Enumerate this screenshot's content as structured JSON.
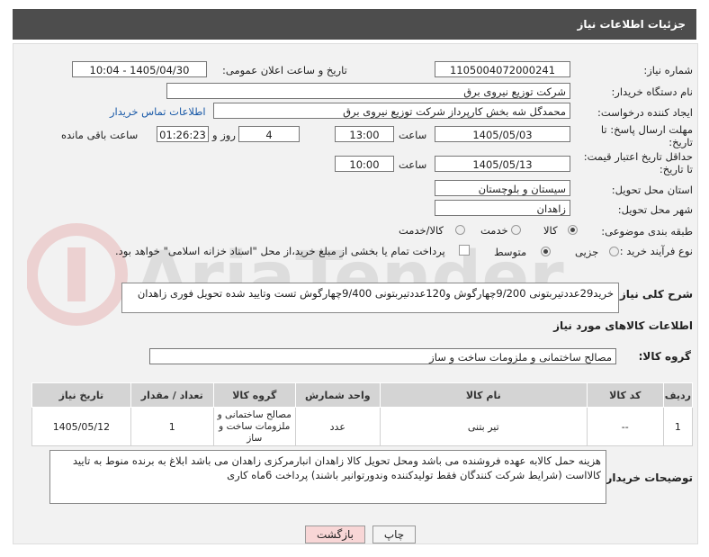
{
  "header": {
    "title": "جزئیات اطلاعات نیاز"
  },
  "fields": {
    "need_number_label": "شماره نیاز:",
    "need_number": "1105004072000241",
    "announce_label": "تاریخ و ساعت اعلان عمومی:",
    "announce_value": "1405/04/30 - 10:04",
    "buyer_org_label": "نام دستگاه خریدار:",
    "buyer_org": "شرکت توزیع نیروی برق",
    "requester_label": "ایجاد کننده درخواست:",
    "requester": "محمدگل شه بخش کارپرداز شرکت توزیع نیروی برق",
    "buyer_contact_link": "اطلاعات تماس خریدار",
    "deadline_label": "مهلت ارسال پاسخ: تا تاریخ:",
    "deadline_date": "1405/05/03",
    "time_label": "ساعت",
    "deadline_time": "13:00",
    "days_value": "4",
    "days_label": "روز و",
    "remaining_time": "01:26:23",
    "remaining_label": "ساعت باقی مانده",
    "validity_label": "حداقل تاریخ اعتبار قیمت: تا تاریخ:",
    "validity_date": "1405/05/13",
    "validity_time": "10:00",
    "province_label": "استان محل تحویل:",
    "province": "سیستان و بلوچستان",
    "city_label": "شهر محل تحویل:",
    "city": "زاهدان",
    "category_label": "طبقه بندی موضوعی:",
    "category_options": [
      "کالا",
      "خدمت",
      "کالا/خدمت"
    ],
    "process_label": "نوع فرآیند خرید :",
    "process_options": [
      "جزیی",
      "متوسط"
    ],
    "payment_note": "پرداخت تمام یا بخشی از مبلغ خرید،از محل \"اسناد خزانه اسلامی\" خواهد بود.",
    "description_label": "شرح کلی نیاز:",
    "description": "خرید29عددتیربتونی 9/200چهارگوش و120عددتیربتونی 9/400چهارگوش تست وتایید شده تحویل فوری زاهدان",
    "goods_info_title": "اطلاعات کالاهای مورد نیاز",
    "goods_group_label": "گروه کالا:",
    "goods_group": "مصالح ساختمانی و ملزومات ساخت و ساز"
  },
  "table": {
    "headers": [
      "ردیف",
      "کد کالا",
      "نام کالا",
      "واحد شمارش",
      "گروه کالا",
      "تعداد / مقدار",
      "تاریخ نیاز"
    ],
    "rows": [
      [
        "1",
        "--",
        "تیر بتنی",
        "عدد",
        "مصالح ساختمانی و ملزومات ساخت و ساز",
        "1",
        "1405/05/12"
      ]
    ]
  },
  "buyer_notes_label": "توضیحات خریدار:",
  "buyer_notes": "هزینه حمل کالابه عهده فروشنده می باشد ومحل تحویل کالا زاهدان انبارمرکزی زاهدان می باشد  ابلاغ به برنده منوط به تایید کالااست (شرایط شرکت کنندگان فقط تولیدکننده   وندورتوانیر باشند) پرداخت 6ماه کاری",
  "buttons": {
    "print": "چاپ",
    "back": "بازگشت"
  },
  "watermark": "AriaTender.net",
  "colors": {
    "header": "#4d4d4d",
    "link": "#1a5aa8",
    "back_button": "#f8d6d6"
  }
}
